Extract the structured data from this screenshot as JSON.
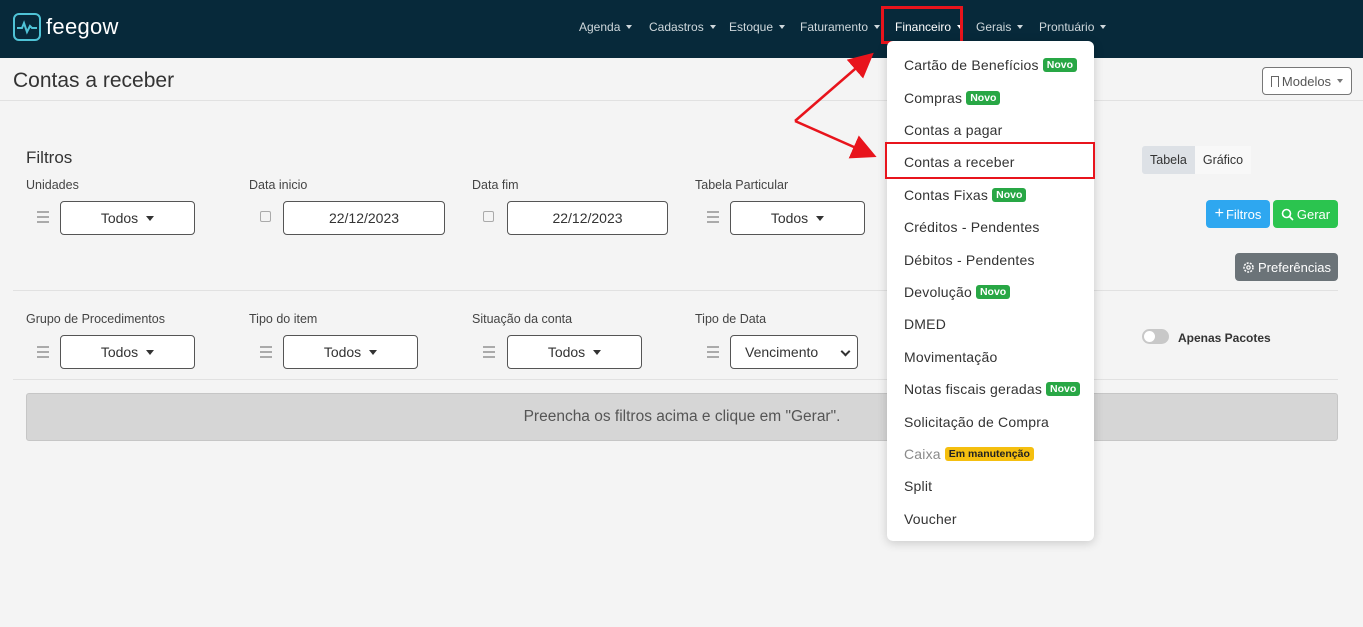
{
  "brand": {
    "name": "feegow"
  },
  "nav": {
    "items": [
      {
        "label": "Agenda"
      },
      {
        "label": "Cadastros"
      },
      {
        "label": "Estoque"
      },
      {
        "label": "Faturamento"
      },
      {
        "label": "Financeiro"
      },
      {
        "label": "Gerais"
      },
      {
        "label": "Prontuário"
      }
    ],
    "active": "Financeiro"
  },
  "page": {
    "title": "Contas a receber",
    "models_label": "Modelos"
  },
  "filters": {
    "title": "Filtros",
    "unidades": {
      "label": "Unidades",
      "value": "Todos"
    },
    "data_inicio": {
      "label": "Data inicio",
      "value": "22/12/2023"
    },
    "data_fim": {
      "label": "Data fim",
      "value": "22/12/2023"
    },
    "tabela_particular": {
      "label": "Tabela Particular",
      "value": "Todos"
    },
    "grupo_procedimentos": {
      "label": "Grupo de Procedimentos",
      "value": "Todos"
    },
    "tipo_item": {
      "label": "Tipo do item",
      "value": "Todos"
    },
    "situacao_conta": {
      "label": "Situação da conta",
      "value": "Todos"
    },
    "tipo_data": {
      "label": "Tipo de Data",
      "value": "Vencimento"
    },
    "apenas_pacotes": {
      "label": "Apenas Pacotes",
      "checked": false
    }
  },
  "view_toggle": {
    "table": "Tabela",
    "chart": "Gráfico",
    "selected": "Tabela"
  },
  "buttons": {
    "filtros": "Filtros",
    "gerar": "Gerar",
    "preferencias": "Preferências"
  },
  "info_message": "Preencha os filtros acima e clique em \"Gerar\".",
  "dropdown": {
    "items": [
      {
        "label": "Cartão de Benefícios",
        "badge": "Novo"
      },
      {
        "label": "Compras",
        "badge": "Novo"
      },
      {
        "label": "Contas a pagar",
        "badge": ""
      },
      {
        "label": "Contas a receber",
        "badge": ""
      },
      {
        "label": "Contas Fixas",
        "badge": "Novo"
      },
      {
        "label": "Créditos - Pendentes",
        "badge": ""
      },
      {
        "label": "Débitos - Pendentes",
        "badge": ""
      },
      {
        "label": "Devolução",
        "badge": "Novo"
      },
      {
        "label": "DMED",
        "badge": ""
      },
      {
        "label": "Movimentação",
        "badge": ""
      },
      {
        "label": "Notas fiscais geradas",
        "badge": "Novo"
      },
      {
        "label": "Solicitação de Compra",
        "badge": ""
      },
      {
        "label": "Caixa",
        "badge": "Em manutenção"
      },
      {
        "label": "Split",
        "badge": ""
      },
      {
        "label": "Voucher",
        "badge": ""
      }
    ]
  },
  "colors": {
    "navbar": "#07293a",
    "highlight": "#e8141c",
    "badge_new": "#28a745",
    "badge_warn": "#f5bf0f",
    "btn_blue": "#2ea7f0",
    "btn_green": "#2bc44f"
  }
}
